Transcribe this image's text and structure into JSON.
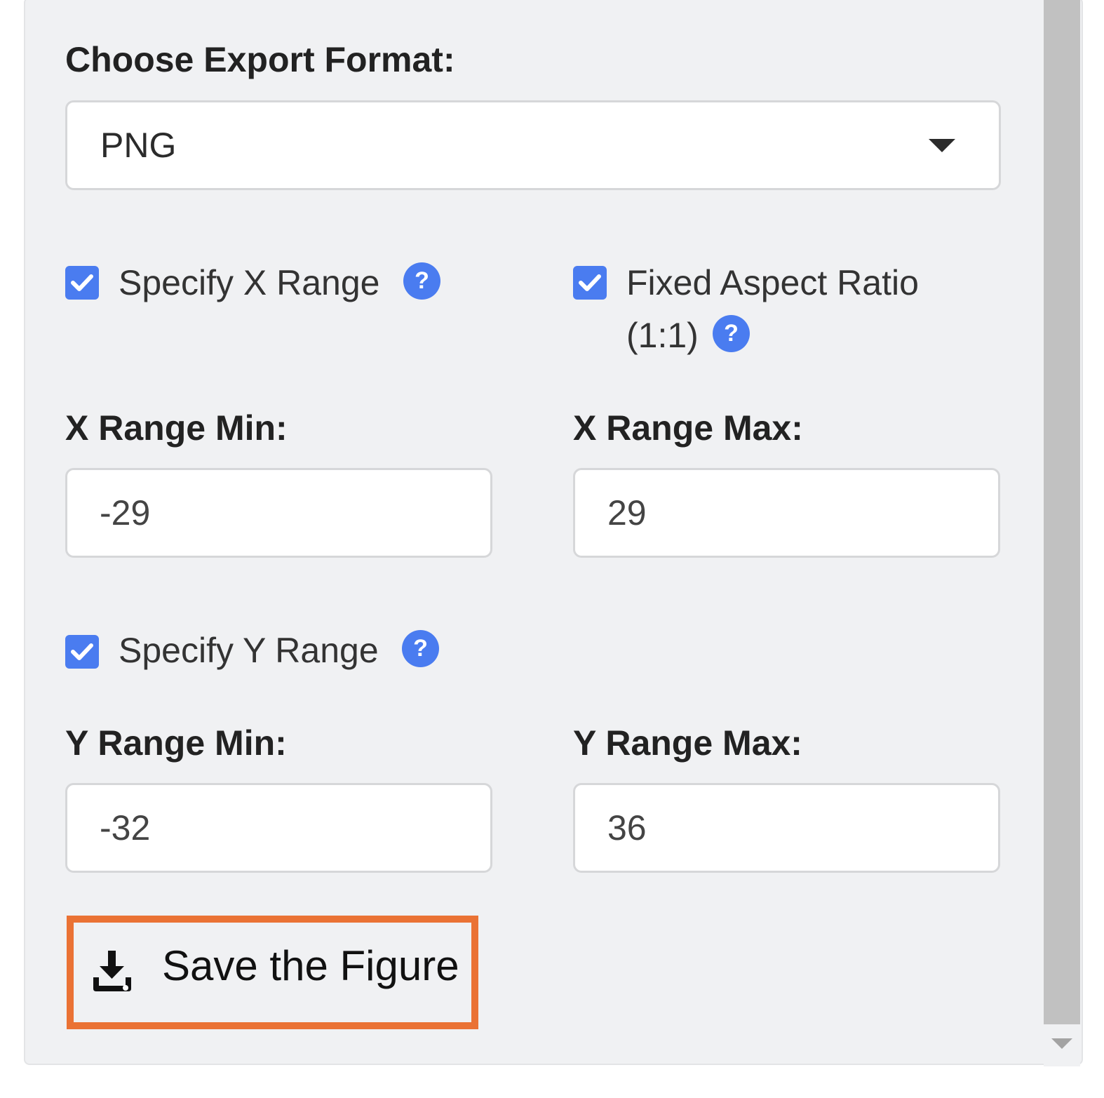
{
  "export": {
    "label": "Choose Export Format:",
    "selected": "PNG"
  },
  "options": {
    "specify_x": {
      "label": "Specify X Range",
      "checked": true,
      "help": "?"
    },
    "fixed_aspect": {
      "label_line1": "Fixed Aspect Ratio",
      "label_line2": "(1:1)",
      "checked": true,
      "help": "?"
    },
    "specify_y": {
      "label": "Specify Y Range",
      "checked": true,
      "help": "?"
    }
  },
  "x_range": {
    "min_label": "X Range Min:",
    "min_value": "-29",
    "max_label": "X Range Max:",
    "max_value": "29"
  },
  "y_range": {
    "min_label": "Y Range Min:",
    "min_value": "-32",
    "max_label": "Y Range Max:",
    "max_value": "36"
  },
  "save_button": {
    "label": "Save the Figure",
    "icon": "download-icon"
  },
  "colors": {
    "accent": "#4a7cf0",
    "highlight": "#ea7234",
    "panel_bg": "#f0f1f3"
  }
}
